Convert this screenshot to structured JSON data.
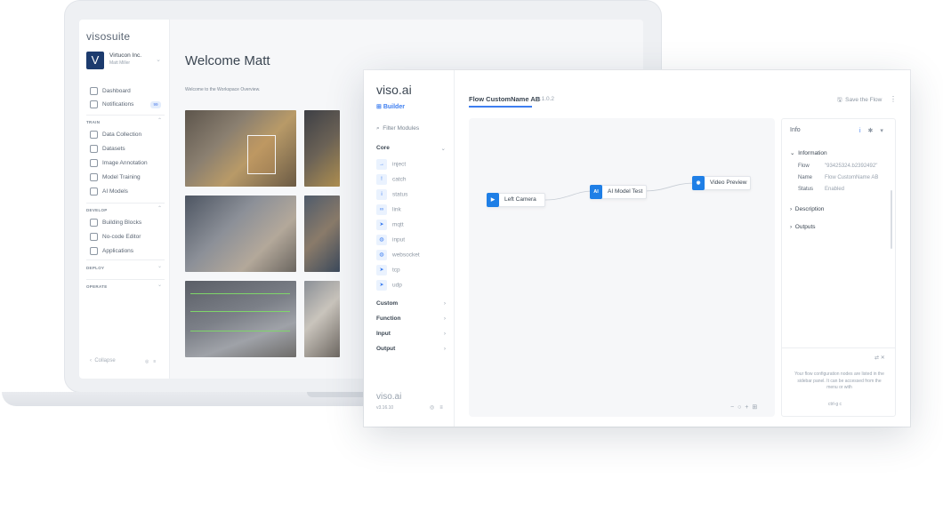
{
  "laptop": {
    "logo": "visosuite",
    "org": {
      "initial": "V",
      "name": "Virtucon Inc.",
      "user": "Matt Miller"
    },
    "nav": {
      "dashboard": "Dashboard",
      "notifications": "Notifications",
      "notifications_badge": "99",
      "train_label": "TRAIN",
      "data_collection": "Data Collection",
      "datasets": "Datasets",
      "image_annotation": "Image Annotation",
      "model_training": "Model Training",
      "ai_models": "AI Models",
      "develop_label": "DEVELOP",
      "building_blocks": "Building Blocks",
      "no_code_editor": "No-code Editor",
      "applications": "Applications",
      "deploy_label": "DEPLOY",
      "operate_label": "OPERATE",
      "collapse": "Collapse"
    },
    "welcome": "Welcome Matt",
    "subtitle": "Welcome to the Workspace Overview."
  },
  "app": {
    "logo": "viso.ai",
    "builder_label": "Builder",
    "filter_placeholder": "Filter Modules",
    "groups": {
      "core": "Core",
      "custom": "Custom",
      "function": "Function",
      "input": "Input",
      "output": "Output"
    },
    "core_nodes": [
      "inject",
      "catch",
      "status",
      "link",
      "mqtt",
      "input",
      "websocket",
      "tcp",
      "udp"
    ],
    "footer_logo": "viso.ai",
    "version": "v3.16.10",
    "flow_title": "Flow CustomName AB",
    "flow_version": "v.1.0.2",
    "save_label": "Save the Flow",
    "nodes": {
      "left_camera": "Left Camera",
      "ai_model_test": "AI Model Test",
      "ai_badge": "AI",
      "video_preview": "Video Preview"
    },
    "info": {
      "title": "Info",
      "information_label": "Information",
      "flow_key": "Flow",
      "flow_value": "\"93425324.b2392492\"",
      "name_key": "Name",
      "name_value": "Flow CustomName AB",
      "status_key": "Status",
      "status_value": "Enabled",
      "description_label": "Description",
      "outputs_label": "Outputs",
      "help_text": "Your flow configuration nodes are listed in the sidebar panel. It can be accessed from the menu or with",
      "shortcut": "ctrl-g c"
    }
  },
  "colors": {
    "accent": "#3d7ef0",
    "node_blue": "#1f7fe6",
    "brand_dark": "#1c3b6e"
  }
}
